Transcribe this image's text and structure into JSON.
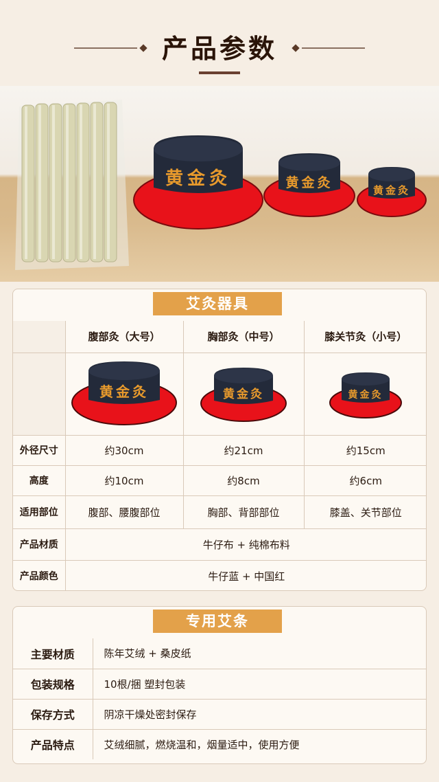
{
  "header": {
    "title": "产品参数"
  },
  "hat_label": "黄金灸",
  "moxa_card": {
    "title": "艾灸器具",
    "columns": [
      "腹部灸（大号）",
      "胸部灸（中号）",
      "膝关节灸（小号）"
    ],
    "rows": [
      {
        "label": "外径尺寸",
        "values": [
          "约30cm",
          "约21cm",
          "约15cm"
        ]
      },
      {
        "label": "高度",
        "values": [
          "约10cm",
          "约8cm",
          "约6cm"
        ]
      },
      {
        "label": "适用部位",
        "values": [
          "腹部、腰腹部位",
          "胸部、背部部位",
          "膝盖、关节部位"
        ]
      }
    ],
    "material": {
      "label": "产品材质",
      "value": "牛仔布 + 纯棉布料"
    },
    "color": {
      "label": "产品颜色",
      "value": "牛仔蓝 + 中国红"
    }
  },
  "stick_card": {
    "title": "专用艾条",
    "rows": [
      {
        "label": "主要材质",
        "value": "陈年艾绒 + 桑皮纸"
      },
      {
        "label": "包装规格",
        "value": "10根/捆 塑封包装"
      },
      {
        "label": "保存方式",
        "value": "阴凉干燥处密封保存"
      },
      {
        "label": "产品特点",
        "value": "艾绒细腻，燃烧温和，烟量适中，使用方便"
      }
    ]
  },
  "colors": {
    "accent": "#e3a14a",
    "hat_red": "#e8121a",
    "hat_denim": "#232a3a",
    "embroidery": "#e89a2c"
  }
}
